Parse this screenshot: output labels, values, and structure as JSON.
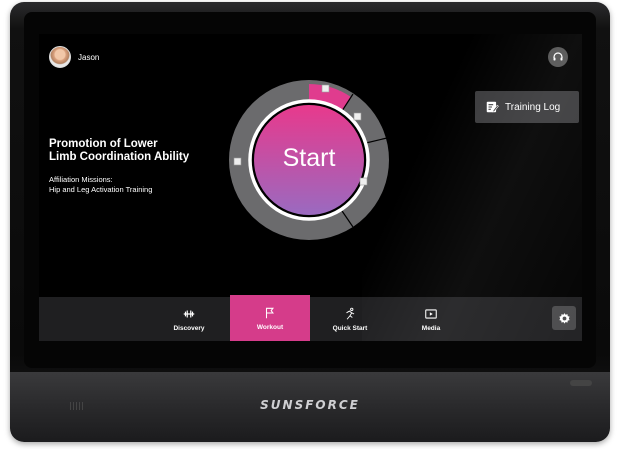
{
  "brand": "SUNSFORCE",
  "user": {
    "name": "Jason",
    "avatar_icon": "user-avatar"
  },
  "header": {
    "support_icon": "headset-icon"
  },
  "program": {
    "title_line1": "Promotion of Lower",
    "title_line2": "Limb Coordination Ability",
    "mission_line1": "Affiliation Missions:",
    "mission_line2": "Hip and Leg Activation Training"
  },
  "training_log": {
    "label": "Training Log",
    "icon": "training-log-icon"
  },
  "start": {
    "label": "Start"
  },
  "nav": {
    "items": [
      {
        "label": "Discovery",
        "icon": "discovery-icon",
        "active": false
      },
      {
        "label": "Workout",
        "icon": "flag-icon",
        "active": true
      },
      {
        "label": "Quick Start",
        "icon": "running-icon",
        "active": false
      },
      {
        "label": "Media",
        "icon": "media-icon",
        "active": false
      }
    ],
    "settings_icon": "gear-icon"
  },
  "colors": {
    "accent": "#d53c8a",
    "ring_gray": "#6b6b6d",
    "nav_bg": "#1f1f21",
    "screen_bg": "#000000"
  }
}
